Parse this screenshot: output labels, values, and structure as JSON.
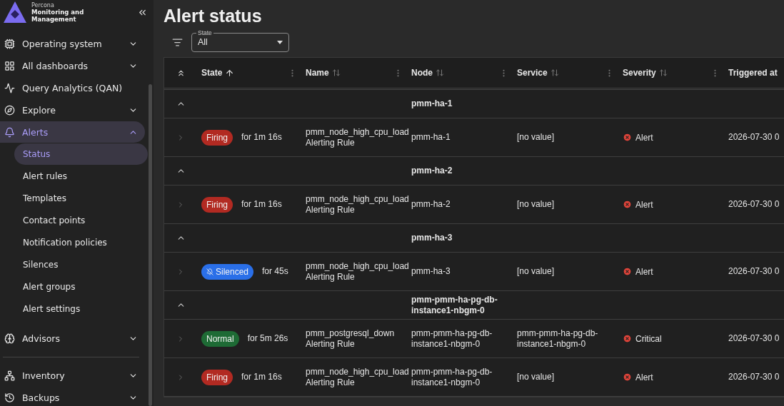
{
  "sidebar": {
    "logo": {
      "brand": "Percona",
      "product": "Monitoring and Management"
    },
    "items": [
      {
        "label": "Operating system",
        "expanded": false,
        "selected": false
      },
      {
        "label": "All dashboards",
        "expanded": false,
        "selected": false
      },
      {
        "label": "Query Analytics (QAN)",
        "selected": false
      },
      {
        "label": "Explore",
        "expanded": false,
        "selected": false
      },
      {
        "label": "Alerts",
        "expanded": true,
        "selected": true,
        "children": [
          {
            "label": "Status",
            "selected": true
          },
          {
            "label": "Alert rules",
            "selected": false
          },
          {
            "label": "Templates",
            "selected": false
          },
          {
            "label": "Contact points",
            "selected": false
          },
          {
            "label": "Notification policies",
            "selected": false
          },
          {
            "label": "Silences",
            "selected": false
          },
          {
            "label": "Alert groups",
            "selected": false
          },
          {
            "label": "Alert settings",
            "selected": false
          }
        ]
      },
      {
        "label": "Advisors",
        "expanded": false,
        "selected": false
      },
      {
        "label": "Inventory",
        "expanded": false,
        "selected": false,
        "divider_before": true
      },
      {
        "label": "Backups",
        "expanded": false,
        "selected": false
      }
    ]
  },
  "page": {
    "title": "Alert status"
  },
  "filter": {
    "label": "State",
    "value": "All"
  },
  "table": {
    "columns": [
      {
        "label": "State",
        "sorted": true
      },
      {
        "label": "Name",
        "sorted": false
      },
      {
        "label": "Node",
        "sorted": false
      },
      {
        "label": "Service",
        "sorted": false
      },
      {
        "label": "Severity",
        "sorted": false
      },
      {
        "label": "Triggered at"
      }
    ],
    "groups": [
      {
        "node": "pmm-ha-1",
        "expanded": true,
        "alerts": [
          {
            "state": "Firing",
            "kind": "firing",
            "duration": "for 1m 16s",
            "name": "pmm_node_high_cpu_load",
            "rule": "Alerting Rule",
            "node": "pmm-ha-1",
            "service": "[no value]",
            "severity": "Alert",
            "triggered": "2026-07-30 0",
            "expanded": false
          }
        ]
      },
      {
        "node": "pmm-ha-2",
        "expanded": true,
        "alerts": [
          {
            "state": "Firing",
            "kind": "firing",
            "duration": "for 1m 16s",
            "name": "pmm_node_high_cpu_load",
            "rule": "Alerting Rule",
            "node": "pmm-ha-2",
            "service": "[no value]",
            "severity": "Alert",
            "triggered": "2026-07-30 0",
            "expanded": false
          }
        ]
      },
      {
        "node": "pmm-ha-3",
        "expanded": true,
        "alerts": [
          {
            "state": "Silenced",
            "kind": "silenced",
            "duration": "for 45s",
            "name": "pmm_node_high_cpu_load",
            "rule": "Alerting Rule",
            "node": "pmm-ha-3",
            "service": "[no value]",
            "severity": "Alert",
            "triggered": "2026-07-30 0",
            "expanded": false
          }
        ]
      },
      {
        "node": "pmm-pmm-ha-pg-db-instance1-nbgm-0",
        "expanded": true,
        "alerts": [
          {
            "state": "Normal",
            "kind": "normal",
            "duration": "for 5m 26s",
            "name": "pmm_postgresql_down",
            "rule": "Alerting Rule",
            "node": "pmm-pmm-ha-pg-db-instance1-nbgm-0",
            "service": "pmm-pmm-ha-pg-db-instance1-nbgm-0",
            "severity": "Critical",
            "triggered": "2026-07-30 0",
            "expanded": false
          },
          {
            "state": "Firing",
            "kind": "firing",
            "duration": "for 1m 16s",
            "name": "pmm_node_high_cpu_load",
            "rule": "Alerting Rule",
            "node": "pmm-pmm-ha-pg-db-instance1-nbgm-0",
            "service": "[no value]",
            "severity": "Alert",
            "triggered": "2026-07-30 0",
            "expanded": false
          }
        ]
      }
    ]
  }
}
